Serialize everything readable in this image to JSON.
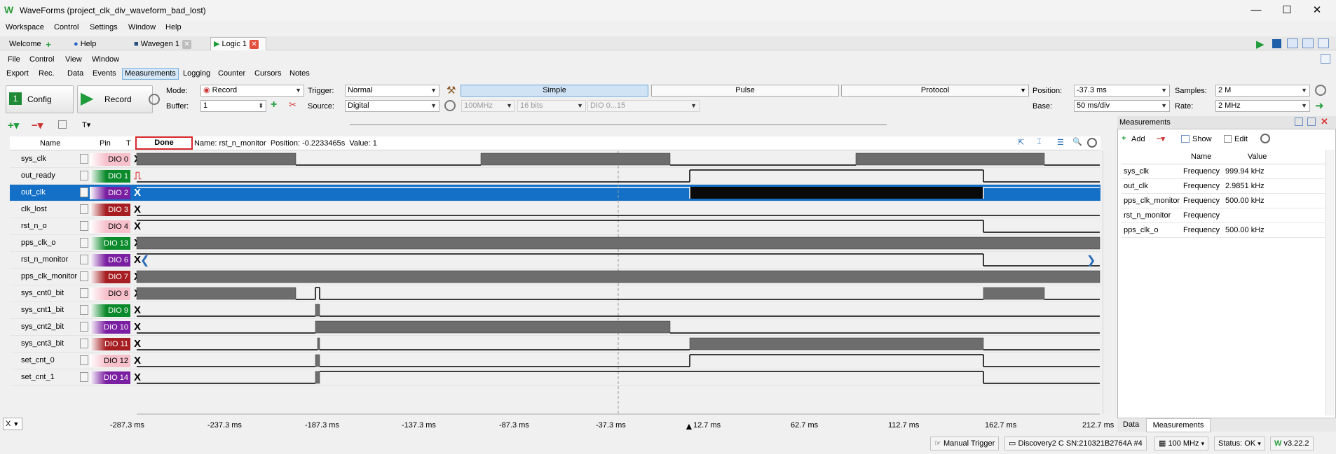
{
  "window": {
    "title": "WaveForms (project_clk_div_waveform_bad_lost)",
    "logo": "W"
  },
  "menu": [
    "Workspace",
    "Control",
    "Settings",
    "Window",
    "Help"
  ],
  "tabs": [
    {
      "label": "Welcome",
      "icon": "plus-icon"
    },
    {
      "label": "Help",
      "icon": "help-icon"
    },
    {
      "label": "Wavegen 1",
      "icon": "wavegen-icon"
    },
    {
      "label": "Logic 1",
      "icon": "play-icon"
    }
  ],
  "submenu": [
    "File",
    "Control",
    "View",
    "Window"
  ],
  "subtabs": [
    "Export",
    "Rec.",
    "Data",
    "Events",
    "Measurements",
    "Logging",
    "Counter",
    "Cursors",
    "Notes"
  ],
  "toolbar": {
    "config": "Config",
    "record": "Record",
    "mode_label": "Mode:",
    "mode": "Record",
    "buffer_label": "Buffer:",
    "buffer": "1",
    "trigger_label": "Trigger:",
    "trigger": "Normal",
    "source_label": "Source:",
    "source": "Digital",
    "rate_sel": "100MHz",
    "bits": "16 bits",
    "dio_range": "DIO 0...15",
    "simple": "Simple",
    "pulse": "Pulse",
    "protocol": "Protocol",
    "position_label": "Position:",
    "position": "-37.3 ms",
    "base_label": "Base:",
    "base": "50 ms/div",
    "samples_label": "Samples:",
    "samples": "2 M",
    "rate_label": "Rate:",
    "rate": "2 MHz"
  },
  "plot_header": {
    "status": "Done",
    "info": "Name: rst_n_monitor  Position: -0.2233465s  Value: 1",
    "col_name": "Name",
    "col_pin": "Pin",
    "col_t": "T"
  },
  "signals": [
    {
      "name": "sys_clk",
      "pin": "DIO 0",
      "color": "#f7c1cc",
      "text": "#000"
    },
    {
      "name": "out_ready",
      "pin": "DIO 1",
      "color": "#0a8a2a",
      "text": "#fff"
    },
    {
      "name": "out_clk",
      "pin": "DIO 2",
      "color": "#7b1fa2",
      "text": "#fff"
    },
    {
      "name": "clk_lost",
      "pin": "DIO 3",
      "color": "#a61e22",
      "text": "#fff"
    },
    {
      "name": "rst_n_o",
      "pin": "DIO 4",
      "color": "#f7c1cc",
      "text": "#000"
    },
    {
      "name": "pps_clk_o",
      "pin": "DIO 13",
      "color": "#0a8a2a",
      "text": "#fff"
    },
    {
      "name": "rst_n_monitor",
      "pin": "DIO 6",
      "color": "#7b1fa2",
      "text": "#fff"
    },
    {
      "name": "pps_clk_monitor",
      "pin": "DIO 7",
      "color": "#a61e22",
      "text": "#fff"
    },
    {
      "name": "sys_cnt0_bit",
      "pin": "DIO 8",
      "color": "#f7c1cc",
      "text": "#000"
    },
    {
      "name": "sys_cnt1_bit",
      "pin": "DIO 9",
      "color": "#0a8a2a",
      "text": "#fff"
    },
    {
      "name": "sys_cnt2_bit",
      "pin": "DIO 10",
      "color": "#7b1fa2",
      "text": "#fff"
    },
    {
      "name": "sys_cnt3_bit",
      "pin": "DIO 11",
      "color": "#a61e22",
      "text": "#fff"
    },
    {
      "name": "set_cnt_0",
      "pin": "DIO 12",
      "color": "#f7c1cc",
      "text": "#000"
    },
    {
      "name": "set_cnt_1",
      "pin": "DIO 14",
      "color": "#7b1fa2",
      "text": "#fff"
    }
  ],
  "time_axis": [
    "-287.3 ms",
    "-237.3 ms",
    "-187.3 ms",
    "-137.3 ms",
    "-87.3 ms",
    "-37.3 ms",
    "12.7 ms",
    "62.7 ms",
    "112.7 ms",
    "162.7 ms",
    "212.7 ms"
  ],
  "measurements": {
    "title": "Measurements",
    "add": "Add",
    "show": "Show",
    "edit": "Edit",
    "col_name": "Name",
    "col_value": "Value",
    "rows": [
      {
        "name": "sys_clk",
        "type": "Frequency",
        "value": "999.94 kHz"
      },
      {
        "name": "out_clk",
        "type": "Frequency",
        "value": "2.9851 kHz"
      },
      {
        "name": "pps_clk_monitor",
        "type": "Frequency",
        "value": "500.00 kHz"
      },
      {
        "name": "rst_n_monitor",
        "type": "Frequency",
        "value": ""
      },
      {
        "name": "pps_clk_o",
        "type": "Frequency",
        "value": "500.00 kHz"
      }
    ],
    "tab_data": "Data",
    "tab_meas": "Measurements"
  },
  "statusbar": {
    "manual": "Manual Trigger",
    "device": "Discovery2 C SN:210321B2764A #4",
    "freq": "100 MHz",
    "status": "Status: OK",
    "version": "v3.22.2"
  },
  "x_label": "X"
}
